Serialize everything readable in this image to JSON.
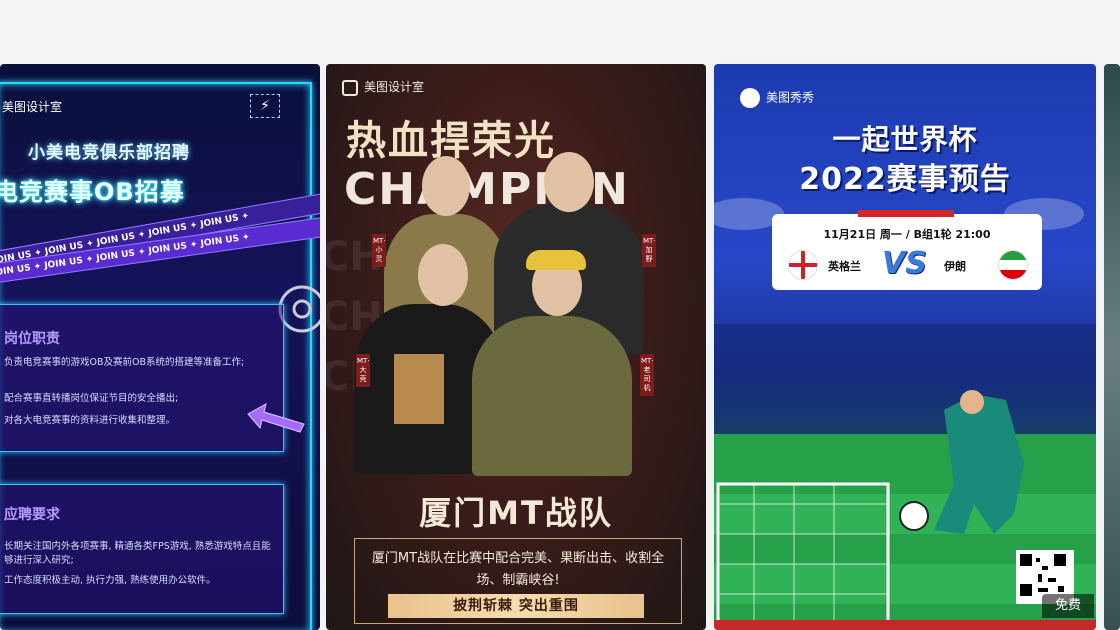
{
  "templates": [
    {
      "brand": "美图设计室",
      "brand_icon": "flash-icon",
      "title_small": "小美电竞俱乐部招聘",
      "title_big": "电竞赛事OB招募",
      "ribbon_text": "✦ JOIN US ✦ JOIN US ✦ JOIN US ✦ JOIN US ✦ JOIN US ✦",
      "section1_title": "岗位职责",
      "section1_lines": [
        "负责电竞赛事的游戏OB及赛前OB系统的搭建等准备工作;",
        "配合赛事直转播岗位保证节目的安全播出;",
        "对各大电竞赛事的资料进行收集和整理。"
      ],
      "section2_title": "应聘要求",
      "section2_lines": [
        "长期关注国内外各项赛事, 精通各类FPS游戏, 熟悉游戏特点且能够进行深入研究;",
        "工作态度积极主动, 执行力强, 熟练使用办公软件。"
      ],
      "accent": "#2ad8ff"
    },
    {
      "brand": "美图设计室",
      "headline": "热血捍荣光",
      "subheadline": "CHAMPION",
      "team_name": "厦门MT战队",
      "description": "厦门MT战队在比赛中配合完美、果断出击、收割全场、制霸峡谷!",
      "slogan": "披荆斩棘 突出重围",
      "tags": [
        "MT·小灵",
        "MT·大壳",
        "MT·加野",
        "MT·老司机"
      ]
    },
    {
      "brand": "美图秀秀",
      "title_line1": "一起世界杯",
      "title_line2": "2022赛事预告",
      "match_info": "11月21日 周一 / B组1轮 21:00",
      "team_home": "英格兰",
      "team_away": "伊朗",
      "vs": "VS",
      "price_badge": "免费"
    }
  ]
}
